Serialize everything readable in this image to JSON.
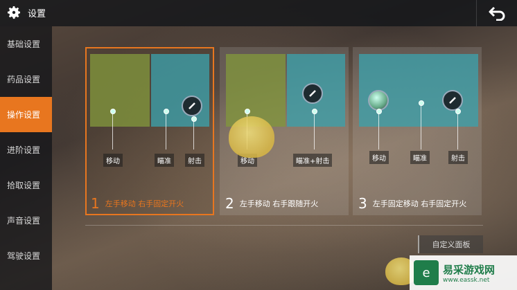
{
  "header": {
    "title": "设置",
    "settings_icon": "gear-icon",
    "back_icon": "return-arrow-icon"
  },
  "sidebar": {
    "items": [
      {
        "label": "基础设置",
        "active": false
      },
      {
        "label": "药品设置",
        "active": false
      },
      {
        "label": "操作设置",
        "active": true
      },
      {
        "label": "进阶设置",
        "active": false
      },
      {
        "label": "拾取设置",
        "active": false
      },
      {
        "label": "声音设置",
        "active": false
      },
      {
        "label": "驾驶设置",
        "active": false
      }
    ]
  },
  "layouts": [
    {
      "number": "1",
      "label": "左手移动 右手固定开火",
      "selected": true,
      "tags": {
        "move": "移动",
        "aim": "瞄准",
        "shoot": "射击"
      }
    },
    {
      "number": "2",
      "label": "左手移动 右手跟随开火",
      "selected": false,
      "tags": {
        "move": "移动",
        "aim_shoot": "瞄准+射击"
      }
    },
    {
      "number": "3",
      "label": "左手固定移动 右手固定开火",
      "selected": false,
      "tags": {
        "move": "移动",
        "aim": "瞄准",
        "shoot": "射击"
      }
    }
  ],
  "custom_panel_button": "自定义面板",
  "colors": {
    "accent": "#e8761f",
    "move_zone": "#829640",
    "aim_zone": "#3ca0aa"
  },
  "watermark": {
    "cn": "易采游戏网",
    "url": "www.eassk.net"
  }
}
